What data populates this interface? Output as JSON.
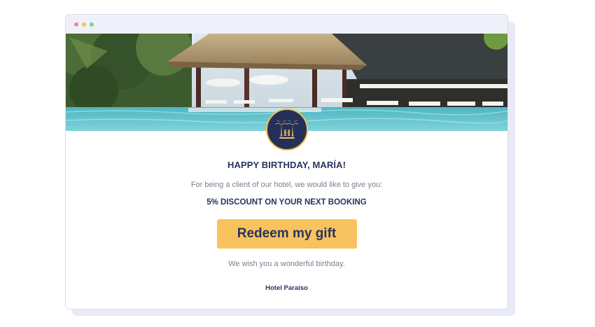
{
  "window": {
    "controls": [
      {
        "name": "close",
        "color": "#f28a8a"
      },
      {
        "name": "minimize",
        "color": "#f5c24f"
      },
      {
        "name": "maximize",
        "color": "#6fd49b"
      }
    ]
  },
  "hero": {
    "image": "resort-pool-with-thatched-cabanas-and-sun-loungers"
  },
  "logo": {
    "icon": "palm-trees-hotel-logo-icon",
    "letter": "H"
  },
  "email": {
    "greeting": "HAPPY BIRTHDAY, MARÍA!",
    "intro": "For being a client of our hotel, we would like to give you:",
    "offer": "5% DISCOUNT ON YOUR NEXT BOOKING",
    "cta_label": "Redeem my gift",
    "wish": "We wish you a wonderful birthday.",
    "signature": "Hotel Paraíso"
  },
  "colors": {
    "navy": "#28335e",
    "accent": "#f8c35f",
    "muted_text": "#7b7f90",
    "window_bg": "#eef1fa"
  }
}
